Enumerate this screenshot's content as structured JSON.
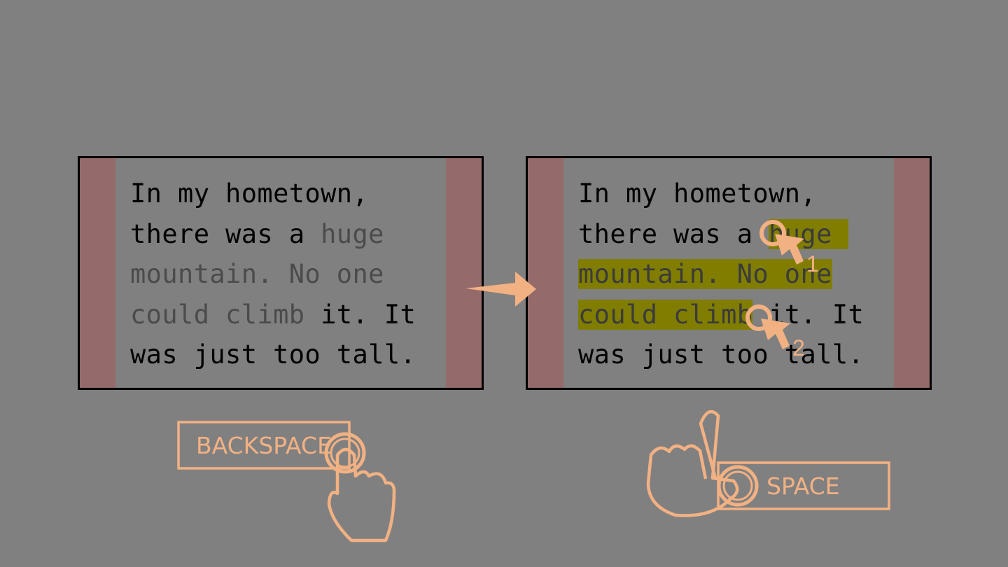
{
  "left_panel": {
    "lines": [
      {
        "before": "In my hometown,",
        "dim": "",
        "after": ""
      },
      {
        "before": "there was a ",
        "dim": "huge",
        "after": ""
      },
      {
        "before": "",
        "dim": "mountain. No one",
        "after": ""
      },
      {
        "before": "",
        "dim": "could climb",
        "after": " it. It"
      },
      {
        "before": "was just too tall.",
        "dim": "",
        "after": ""
      }
    ]
  },
  "right_panel": {
    "lines": [
      {
        "before": "In my hometown,",
        "hl": "",
        "after": ""
      },
      {
        "before": "there was a ",
        "hl": "huge ",
        "after": ""
      },
      {
        "before": "",
        "hl": "mountain. No one",
        "after": ""
      },
      {
        "before": "",
        "hl": "could climb",
        "after": " it. It"
      },
      {
        "before": "was just too tall.",
        "hl": "",
        "after": ""
      }
    ],
    "markers": [
      "1",
      "2"
    ]
  },
  "keys": {
    "backspace": "BACKSPACE",
    "space": "SPACE"
  },
  "colors": {
    "accent": "#f2b183",
    "margin": "#956a6a",
    "highlight": "#807d00",
    "background": "#808080"
  },
  "icons": [
    "right-arrow-icon",
    "cursor-arrow-icon",
    "pointing-hand-icon"
  ]
}
